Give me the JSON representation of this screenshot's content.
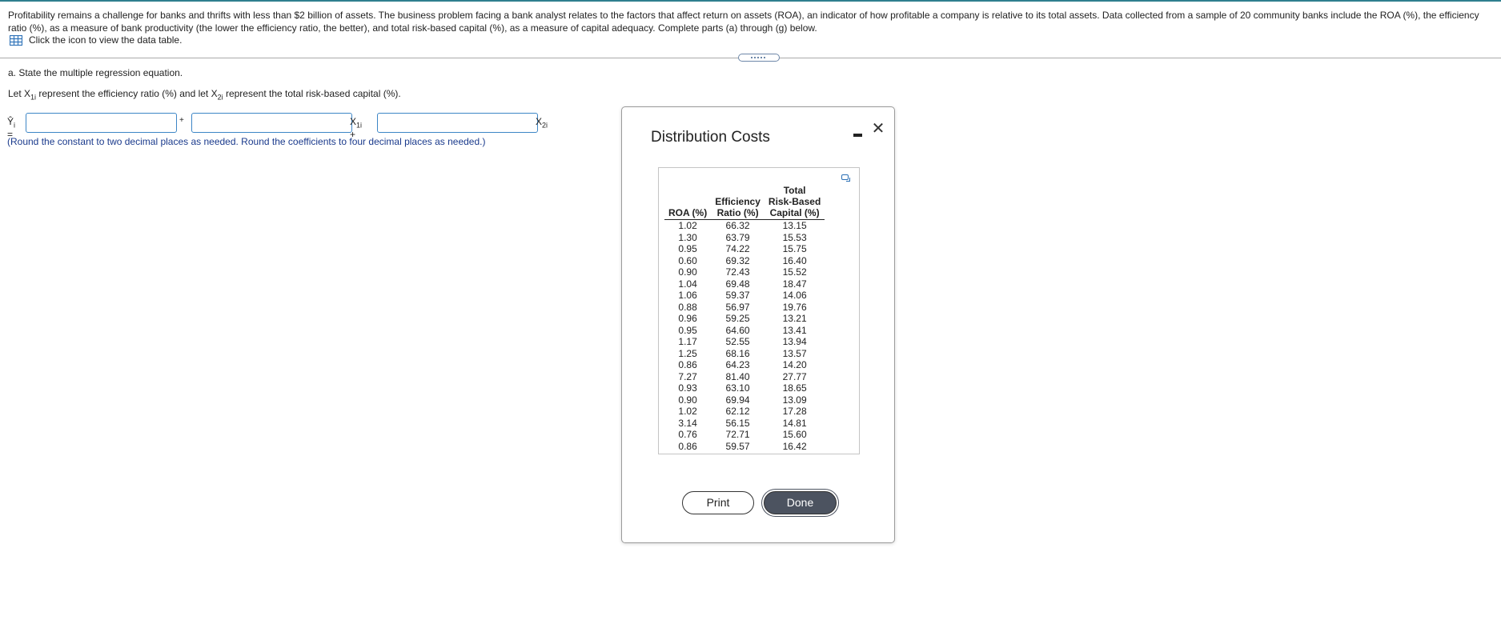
{
  "question": {
    "text": "Profitability remains a challenge for banks and thrifts with less than $2 billion of assets. The business problem facing a bank analyst relates to the factors that affect return on assets (ROA), an indicator of how profitable a company is relative to its total assets. Data collected from a sample of 20 community banks include the ROA (%), the efficiency ratio (%), as a measure of bank productivity (the lower the efficiency ratio, the better), and total risk-based capital (%), as a measure of capital adequacy. Complete parts (a) through (g) below.",
    "table_link": "Click the icon to view the data table."
  },
  "part_a": {
    "heading": "a. State the multiple regression equation.",
    "let_prefix": "Let X",
    "let_sub1": "1i",
    "let_mid": " represent the efficiency ratio (%) and let X",
    "let_sub2": "2i",
    "let_suffix": " represent the total risk-based capital (%).",
    "yhat": "Ŷ",
    "yhat_sub": "i",
    "equals": " =",
    "plus": "+",
    "x1": "X",
    "x1_sub": "1i",
    "x1_plus": " +",
    "x2": "X",
    "x2_sub": "2i",
    "inputs": {
      "constant": "",
      "coef1": "",
      "coef2": ""
    },
    "hint": "(Round the constant to two decimal places as needed. Round the coefficients to four decimal places as needed.)"
  },
  "dialog": {
    "title": "Distribution Costs",
    "print_label": "Print",
    "done_label": "Done"
  },
  "table": {
    "headers": [
      [
        "ROA (%)"
      ],
      [
        "Efficiency",
        "Ratio (%)"
      ],
      [
        "Total",
        "Risk-Based",
        "Capital (%)"
      ]
    ],
    "rows": [
      [
        "1.02",
        "66.32",
        "13.15"
      ],
      [
        "1.30",
        "63.79",
        "15.53"
      ],
      [
        "0.95",
        "74.22",
        "15.75"
      ],
      [
        "0.60",
        "69.32",
        "16.40"
      ],
      [
        "0.90",
        "72.43",
        "15.52"
      ],
      [
        "1.04",
        "69.48",
        "18.47"
      ],
      [
        "1.06",
        "59.37",
        "14.06"
      ],
      [
        "0.88",
        "56.97",
        "19.76"
      ],
      [
        "0.96",
        "59.25",
        "13.21"
      ],
      [
        "0.95",
        "64.60",
        "13.41"
      ],
      [
        "1.17",
        "52.55",
        "13.94"
      ],
      [
        "1.25",
        "68.16",
        "13.57"
      ],
      [
        "0.86",
        "64.23",
        "14.20"
      ],
      [
        "7.27",
        "81.40",
        "27.77"
      ],
      [
        "0.93",
        "63.10",
        "18.65"
      ],
      [
        "0.90",
        "69.94",
        "13.09"
      ],
      [
        "1.02",
        "62.12",
        "17.28"
      ],
      [
        "3.14",
        "56.15",
        "14.81"
      ],
      [
        "0.76",
        "72.71",
        "15.60"
      ],
      [
        "0.86",
        "59.57",
        "16.42"
      ]
    ]
  },
  "colors": {
    "accent": "#2f7f8f",
    "input_border": "#3d86c6",
    "hint": "#1a3a8c",
    "done_bg": "#4c5360"
  }
}
